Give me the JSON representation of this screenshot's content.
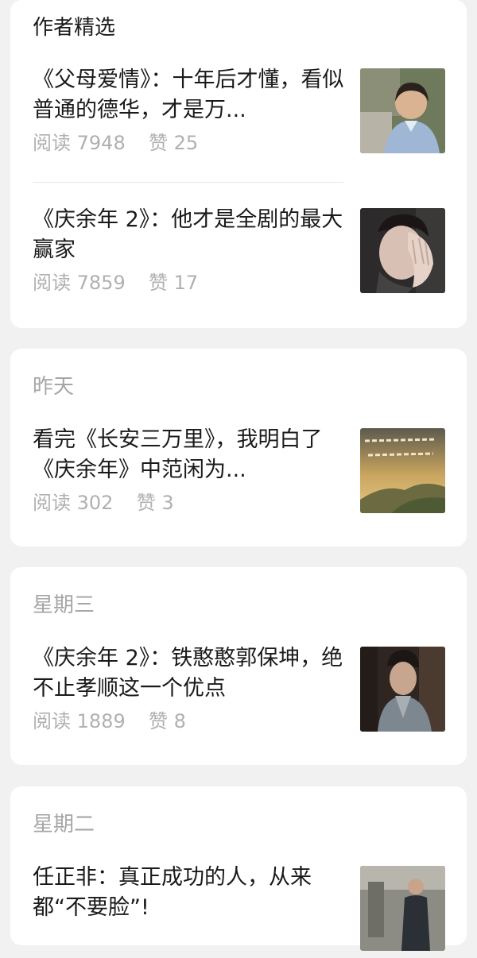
{
  "featured": {
    "title": "作者精选",
    "articles": [
      {
        "title": "《父母爱情》：十年后才懂，看似普通的德华，才是万...",
        "reads_label": "阅读",
        "reads": "7948",
        "likes_label": "赞",
        "likes": "25",
        "thumb_icon": "woman-smiling-photo"
      },
      {
        "title": "《庆余年 2》：他才是全剧的最大赢家",
        "reads_label": "阅读",
        "reads": "7859",
        "likes_label": "赞",
        "likes": "17",
        "thumb_icon": "man-hand-on-face-photo"
      }
    ]
  },
  "groups": [
    {
      "date": "昨天",
      "article": {
        "title": "看完《长安三万里》，我明白了《庆余年》中范闲为...",
        "reads_label": "阅读",
        "reads": "302",
        "likes_label": "赞",
        "likes": "3",
        "thumb_icon": "calligraphy-landscape-image"
      }
    },
    {
      "date": "星期三",
      "article": {
        "title": "《庆余年 2》：铁憨憨郭保坤，绝不止孝顺这一个优点",
        "reads_label": "阅读",
        "reads": "1889",
        "likes_label": "赞",
        "likes": "8",
        "thumb_icon": "period-drama-actor-photo"
      }
    },
    {
      "date": "星期二",
      "article": {
        "title": "任正非：真正成功的人，从来都“不要脸”!",
        "thumb_icon": "street-scene-photo"
      }
    }
  ]
}
